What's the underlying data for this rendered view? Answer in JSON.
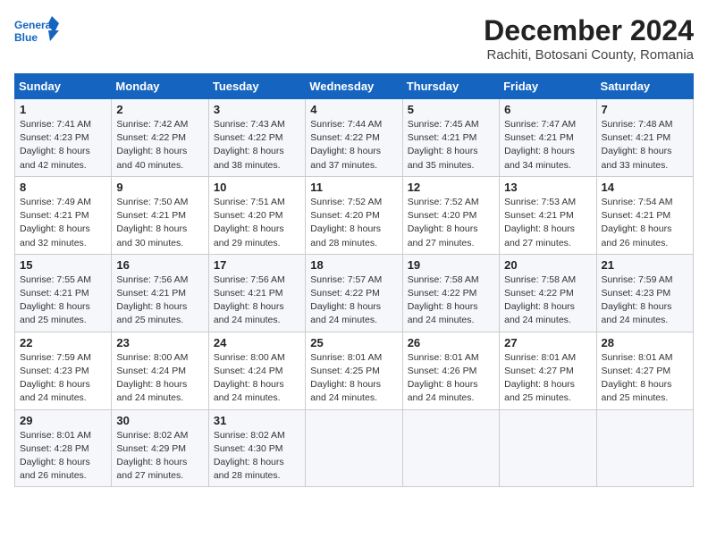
{
  "logo": {
    "line1": "General",
    "line2": "Blue"
  },
  "title": "December 2024",
  "subtitle": "Rachiti, Botosani County, Romania",
  "weekdays": [
    "Sunday",
    "Monday",
    "Tuesday",
    "Wednesday",
    "Thursday",
    "Friday",
    "Saturday"
  ],
  "weeks": [
    [
      {
        "day": "1",
        "sunrise": "7:41 AM",
        "sunset": "4:23 PM",
        "daylight": "8 hours and 42 minutes."
      },
      {
        "day": "2",
        "sunrise": "7:42 AM",
        "sunset": "4:22 PM",
        "daylight": "8 hours and 40 minutes."
      },
      {
        "day": "3",
        "sunrise": "7:43 AM",
        "sunset": "4:22 PM",
        "daylight": "8 hours and 38 minutes."
      },
      {
        "day": "4",
        "sunrise": "7:44 AM",
        "sunset": "4:22 PM",
        "daylight": "8 hours and 37 minutes."
      },
      {
        "day": "5",
        "sunrise": "7:45 AM",
        "sunset": "4:21 PM",
        "daylight": "8 hours and 35 minutes."
      },
      {
        "day": "6",
        "sunrise": "7:47 AM",
        "sunset": "4:21 PM",
        "daylight": "8 hours and 34 minutes."
      },
      {
        "day": "7",
        "sunrise": "7:48 AM",
        "sunset": "4:21 PM",
        "daylight": "8 hours and 33 minutes."
      }
    ],
    [
      {
        "day": "8",
        "sunrise": "7:49 AM",
        "sunset": "4:21 PM",
        "daylight": "8 hours and 32 minutes."
      },
      {
        "day": "9",
        "sunrise": "7:50 AM",
        "sunset": "4:21 PM",
        "daylight": "8 hours and 30 minutes."
      },
      {
        "day": "10",
        "sunrise": "7:51 AM",
        "sunset": "4:20 PM",
        "daylight": "8 hours and 29 minutes."
      },
      {
        "day": "11",
        "sunrise": "7:52 AM",
        "sunset": "4:20 PM",
        "daylight": "8 hours and 28 minutes."
      },
      {
        "day": "12",
        "sunrise": "7:52 AM",
        "sunset": "4:20 PM",
        "daylight": "8 hours and 27 minutes."
      },
      {
        "day": "13",
        "sunrise": "7:53 AM",
        "sunset": "4:21 PM",
        "daylight": "8 hours and 27 minutes."
      },
      {
        "day": "14",
        "sunrise": "7:54 AM",
        "sunset": "4:21 PM",
        "daylight": "8 hours and 26 minutes."
      }
    ],
    [
      {
        "day": "15",
        "sunrise": "7:55 AM",
        "sunset": "4:21 PM",
        "daylight": "8 hours and 25 minutes."
      },
      {
        "day": "16",
        "sunrise": "7:56 AM",
        "sunset": "4:21 PM",
        "daylight": "8 hours and 25 minutes."
      },
      {
        "day": "17",
        "sunrise": "7:56 AM",
        "sunset": "4:21 PM",
        "daylight": "8 hours and 24 minutes."
      },
      {
        "day": "18",
        "sunrise": "7:57 AM",
        "sunset": "4:22 PM",
        "daylight": "8 hours and 24 minutes."
      },
      {
        "day": "19",
        "sunrise": "7:58 AM",
        "sunset": "4:22 PM",
        "daylight": "8 hours and 24 minutes."
      },
      {
        "day": "20",
        "sunrise": "7:58 AM",
        "sunset": "4:22 PM",
        "daylight": "8 hours and 24 minutes."
      },
      {
        "day": "21",
        "sunrise": "7:59 AM",
        "sunset": "4:23 PM",
        "daylight": "8 hours and 24 minutes."
      }
    ],
    [
      {
        "day": "22",
        "sunrise": "7:59 AM",
        "sunset": "4:23 PM",
        "daylight": "8 hours and 24 minutes."
      },
      {
        "day": "23",
        "sunrise": "8:00 AM",
        "sunset": "4:24 PM",
        "daylight": "8 hours and 24 minutes."
      },
      {
        "day": "24",
        "sunrise": "8:00 AM",
        "sunset": "4:24 PM",
        "daylight": "8 hours and 24 minutes."
      },
      {
        "day": "25",
        "sunrise": "8:01 AM",
        "sunset": "4:25 PM",
        "daylight": "8 hours and 24 minutes."
      },
      {
        "day": "26",
        "sunrise": "8:01 AM",
        "sunset": "4:26 PM",
        "daylight": "8 hours and 24 minutes."
      },
      {
        "day": "27",
        "sunrise": "8:01 AM",
        "sunset": "4:27 PM",
        "daylight": "8 hours and 25 minutes."
      },
      {
        "day": "28",
        "sunrise": "8:01 AM",
        "sunset": "4:27 PM",
        "daylight": "8 hours and 25 minutes."
      }
    ],
    [
      {
        "day": "29",
        "sunrise": "8:01 AM",
        "sunset": "4:28 PM",
        "daylight": "8 hours and 26 minutes."
      },
      {
        "day": "30",
        "sunrise": "8:02 AM",
        "sunset": "4:29 PM",
        "daylight": "8 hours and 27 minutes."
      },
      {
        "day": "31",
        "sunrise": "8:02 AM",
        "sunset": "4:30 PM",
        "daylight": "8 hours and 28 minutes."
      },
      null,
      null,
      null,
      null
    ]
  ],
  "labels": {
    "sunrise": "Sunrise:",
    "sunset": "Sunset:",
    "daylight": "Daylight:"
  }
}
